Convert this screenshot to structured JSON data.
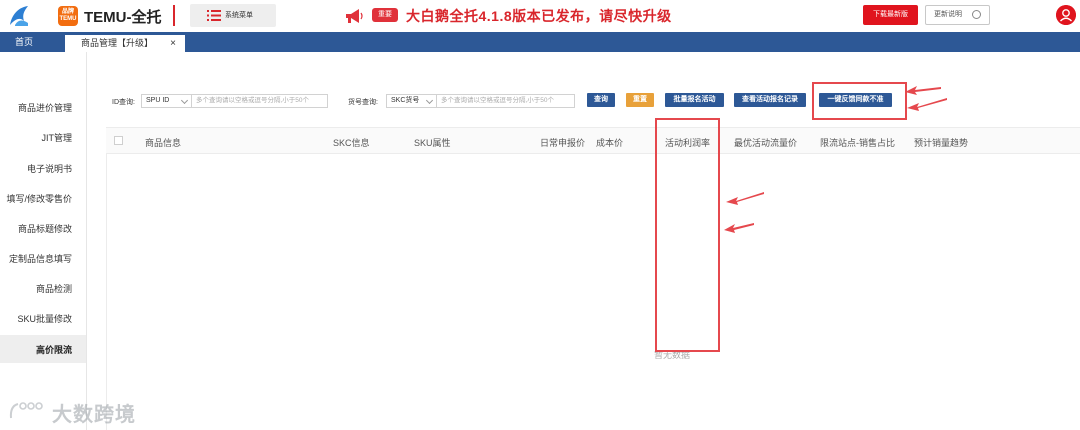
{
  "header": {
    "app_title": "TEMU-全托",
    "temu_badge_top": "品牌",
    "temu_badge_bottom": "TEMU",
    "menu_label": "系统菜单",
    "news_tag": "重要",
    "headline": "大白鹅全托4.1.8版本已发布，请尽快升级",
    "download_label": "下载最新版",
    "update_label": "更新说明",
    "icons": [
      "logo-icon",
      "menu-icon",
      "horn-icon",
      "clock-icon",
      "user-icon"
    ],
    "colors": {
      "brand_red": "#d9262c",
      "nav_blue": "#2d5896",
      "temu_orange": "#f26d10"
    }
  },
  "tabs": {
    "home": "首页",
    "active": "商品管理【升级】",
    "close": "×"
  },
  "sidebar": {
    "items": [
      {
        "label": "商品进价管理"
      },
      {
        "label": "JIT管理"
      },
      {
        "label": "电子说明书"
      },
      {
        "label": "填写/修改零售价"
      },
      {
        "label": "商品标题修改"
      },
      {
        "label": "定制品信息填写"
      },
      {
        "label": "商品检测"
      },
      {
        "label": "SKU批量修改"
      },
      {
        "label": "高价限流"
      }
    ],
    "active_index": 8
  },
  "search": {
    "id_label": "ID查询:",
    "id_select": "SPU ID",
    "id_placeholder": "多个查询请以空格或逗号分隔,小于50个",
    "sku_label": "货号查询:",
    "sku_select": "SKC货号",
    "sku_placeholder": "多个查询请以空格或逗号分隔,小于50个",
    "buttons": {
      "query": "查询",
      "reset": "重置",
      "batch_signup": "批量报名活动",
      "view_records": "查看活动报名记录",
      "feedback": "一键反馈同款不准"
    }
  },
  "table": {
    "columns": [
      "商品信息",
      "SKC信息",
      "SKU属性",
      "日常申报价",
      "成本价",
      "活动利润率",
      "最优活动流量价",
      "限流站点-销售占比",
      "预计销量趋势"
    ],
    "empty_text": "暂无数据"
  },
  "watermark": "大数跨境"
}
